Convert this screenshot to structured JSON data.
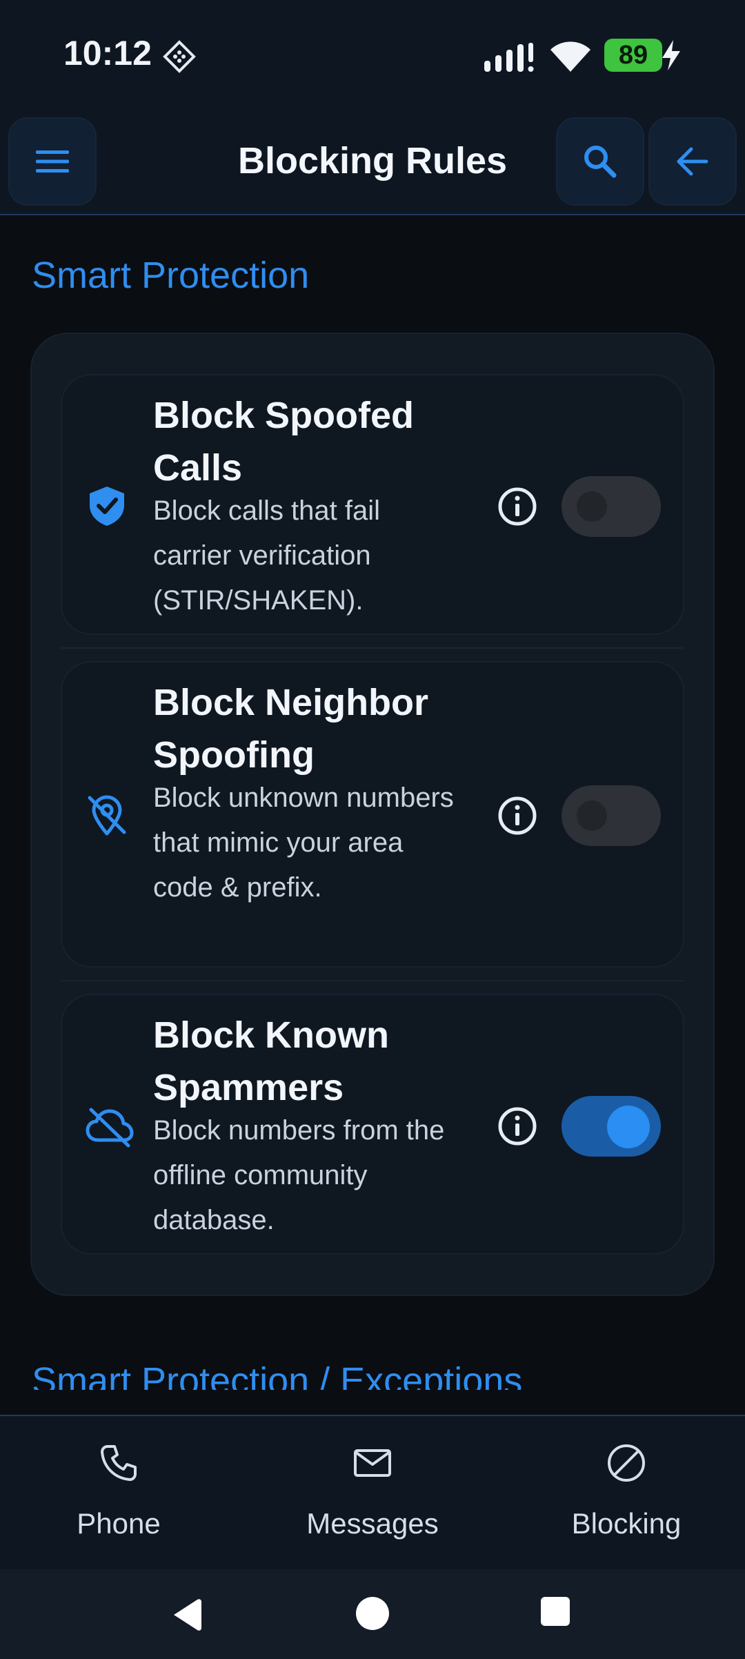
{
  "status_bar": {
    "time": "10:12",
    "battery": "89",
    "icons": [
      "diamond-notification-icon",
      "signal-icon",
      "wifi-icon",
      "battery-icon",
      "charging-bolt-icon"
    ]
  },
  "app_bar": {
    "title": "Blocking Rules",
    "icons": [
      "menu-icon",
      "search-icon",
      "arrow-left-icon"
    ]
  },
  "section": {
    "title": "Smart Protection",
    "next_title": "Smart Protection / Exceptions"
  },
  "rules": [
    {
      "icon": "shield-check-icon",
      "title": "Block Spoofed Calls",
      "description": "Block calls that fail carrier verification (STIR/SHAKEN).",
      "enabled": false
    },
    {
      "icon": "location-off-icon",
      "title": "Block Neighbor Spoofing",
      "description": "Block unknown numbers that mimic your area code & prefix.",
      "enabled": false
    },
    {
      "icon": "cloud-off-icon",
      "title": "Block Known Spammers",
      "description": "Block numbers from the offline community database.",
      "enabled": true
    }
  ],
  "bottom_nav": [
    {
      "label": "Phone",
      "icon": "phone-icon"
    },
    {
      "label": "Messages",
      "icon": "mail-icon"
    },
    {
      "label": "Blocking",
      "icon": "block-icon"
    }
  ],
  "colors": {
    "accent": "#2f8ef0",
    "background": "#0a0d12",
    "toggle_on": "#1a5da6"
  }
}
